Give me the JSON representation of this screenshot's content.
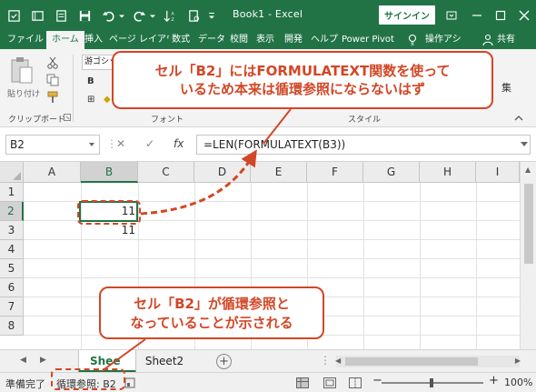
{
  "window": {
    "app_title": "Book1 - Excel",
    "signin_label": "サインイン",
    "title_bg": "#217346"
  },
  "tabs": [
    "ファイル",
    "ホーム",
    "挿入",
    "ページ レイアウ",
    "数式",
    "データ",
    "校閲",
    "表示",
    "開発",
    "ヘルプ",
    "Power Pivot",
    "操作アシ",
    "共有"
  ],
  "ribbon": {
    "font_name": "游ゴシック",
    "paste_label": "貼り付け",
    "groups": [
      "クリップボード",
      "フォント",
      "スタイル"
    ],
    "partial_right_label": "集"
  },
  "formula_bar": {
    "name_box": "B2",
    "cancel_symbol": "✕",
    "enter_symbol": "✓",
    "fx_label": "fx",
    "formula": "=LEN(FORMULATEXT(B3))"
  },
  "grid": {
    "columns": [
      "A",
      "B",
      "C",
      "D",
      "E",
      "F",
      "G",
      "H",
      "I"
    ],
    "rows": [
      "1",
      "2",
      "3",
      "4",
      "5",
      "6",
      "7",
      "8"
    ],
    "b2": "11",
    "b3": "11",
    "active_cell": "B2"
  },
  "sheets": {
    "active_tab": "Shee",
    "other_tab": "Sheet2",
    "add_symbol": "+"
  },
  "status": {
    "ready": "準備完了",
    "circular": "循環参照: B2",
    "zoom": "100%",
    "zoom_minus": "−",
    "zoom_plus": "+"
  },
  "callouts": {
    "top_line1": "セル「B2」にはFORMULATEXT関数を使って",
    "top_line2": "いるため本来は循環参照にならないはず",
    "bottom_line1": "セル「B2」が循環参照と",
    "bottom_line2": "なっていることが示される",
    "accent": "#d24726"
  }
}
